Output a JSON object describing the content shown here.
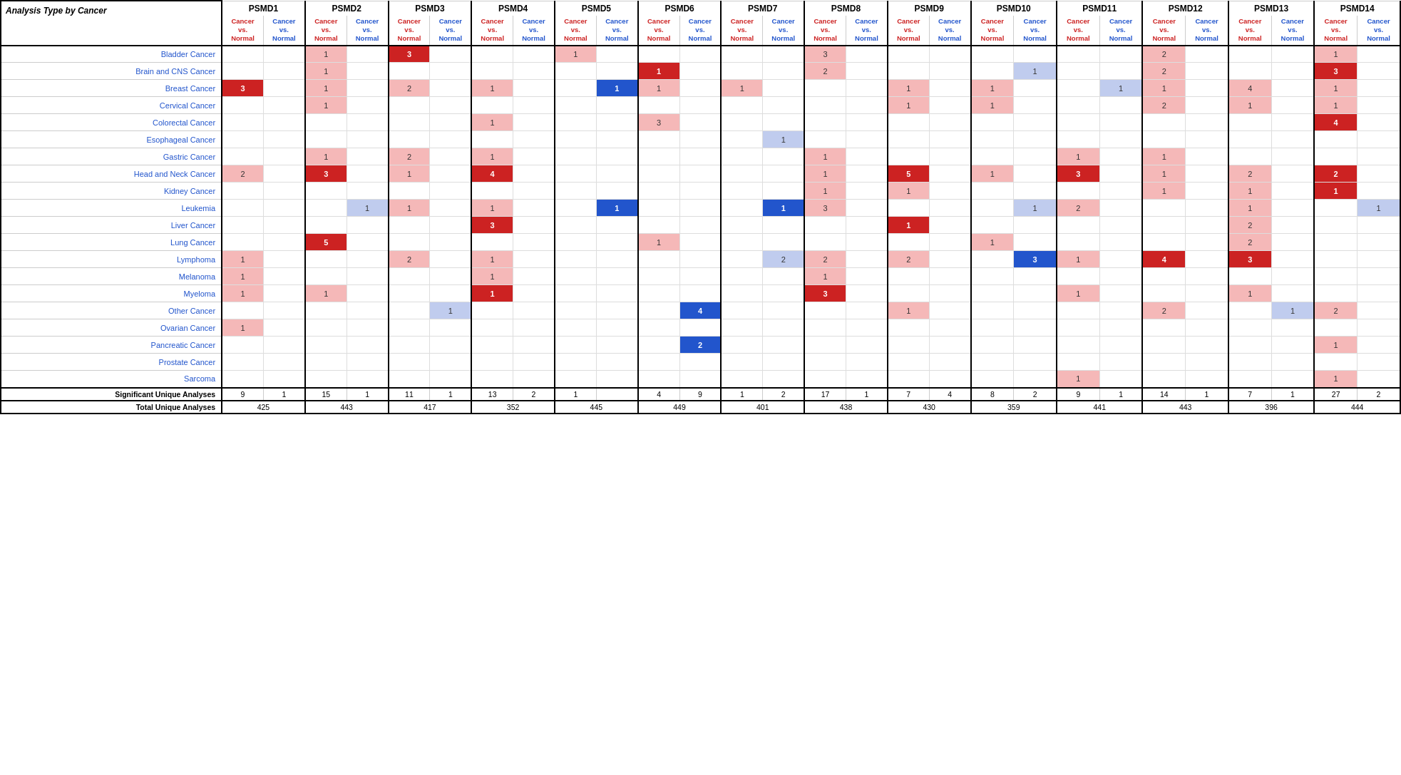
{
  "title": "Analysis Type by Cancer",
  "psmd_columns": [
    {
      "id": "PSMD1",
      "sub": "Cancer vs. Normal"
    },
    {
      "id": "PSMD2",
      "sub": "Cancer vs. Normal"
    },
    {
      "id": "PSMD3",
      "sub": "Cancer vs. Normal"
    },
    {
      "id": "PSMD4",
      "sub": "Cancer vs. Normal"
    },
    {
      "id": "PSMD5",
      "sub": "Cancer vs. Normal"
    },
    {
      "id": "PSMD6",
      "sub": "Cancer vs. Normal"
    },
    {
      "id": "PSMD7",
      "sub": "Cancer vs. Normal"
    },
    {
      "id": "PSMD8",
      "sub": "Cancer vs. Normal"
    },
    {
      "id": "PSMD9",
      "sub": "Cancer vs. Normal"
    },
    {
      "id": "PSMD10",
      "sub": "Cancer vs. Normal"
    },
    {
      "id": "PSMD11",
      "sub": "Cancer vs. Normal"
    },
    {
      "id": "PSMD12",
      "sub": "Cancer vs. Normal"
    },
    {
      "id": "PSMD13",
      "sub": "Cancer vs. Normal"
    },
    {
      "id": "PSMD14",
      "sub": "Cancer vs. Normal"
    }
  ],
  "cancer_rows": [
    {
      "name": "Bladder Cancer",
      "cells": [
        [
          "",
          ""
        ],
        [
          "1",
          "light-red"
        ],
        [
          "3",
          "dark-red"
        ],
        [
          "",
          ""
        ],
        [
          "1",
          "light-red"
        ],
        [
          "",
          ""
        ],
        [
          "",
          ""
        ],
        [
          "3",
          "light-red"
        ],
        [
          "",
          ""
        ],
        [
          "",
          ""
        ],
        [
          "",
          ""
        ],
        [
          "2",
          "light-red"
        ],
        [
          "",
          ""
        ],
        [
          "1",
          "light-red"
        ]
      ]
    },
    {
      "name": "Brain and CNS Cancer",
      "cells": [
        [
          "",
          ""
        ],
        [
          "1",
          "light-red"
        ],
        [
          "",
          ""
        ],
        [
          "",
          ""
        ],
        [
          "",
          ""
        ],
        [
          "1",
          "dark-red"
        ],
        [
          "",
          ""
        ],
        [
          "2",
          "light-red"
        ],
        [
          "",
          ""
        ],
        [
          "1",
          "light-blue"
        ],
        [
          "",
          ""
        ],
        [
          "2",
          "light-red"
        ],
        [
          "",
          ""
        ],
        [
          "3",
          "dark-red"
        ]
      ]
    },
    {
      "name": "Breast Cancer",
      "cells": [
        [
          "3",
          "dark-red"
        ],
        [
          "1",
          "light-red"
        ],
        [
          "2",
          "light-red"
        ],
        [
          "1",
          "light-red"
        ],
        [
          "1",
          "dark-blue"
        ],
        [
          "1",
          "light-red"
        ],
        [
          "1",
          "light-red"
        ],
        [
          "",
          ""
        ],
        [
          "1",
          "light-red"
        ],
        [
          "1",
          "light-red"
        ],
        [
          "1",
          "light-blue"
        ],
        [
          "1",
          "light-red"
        ],
        [
          "4",
          "light-red"
        ],
        [
          "1",
          "light-red"
        ]
      ]
    },
    {
      "name": "Cervical Cancer",
      "cells": [
        [
          "",
          ""
        ],
        [
          "1",
          "light-red"
        ],
        [
          "",
          ""
        ],
        [
          "",
          ""
        ],
        [
          "",
          ""
        ],
        [
          "",
          ""
        ],
        [
          "",
          ""
        ],
        [
          "",
          ""
        ],
        [
          "1",
          "light-red"
        ],
        [
          "1",
          "light-red"
        ],
        [
          "",
          ""
        ],
        [
          "2",
          "light-red"
        ],
        [
          "1",
          "light-red"
        ],
        [
          "1",
          "light-red"
        ]
      ]
    },
    {
      "name": "Colorectal Cancer",
      "cells": [
        [
          "",
          ""
        ],
        [
          "",
          ""
        ],
        [
          "",
          ""
        ],
        [
          "1",
          "light-red"
        ],
        [
          "",
          ""
        ],
        [
          "3",
          "light-red"
        ],
        [
          "",
          ""
        ],
        [
          "",
          ""
        ],
        [
          "",
          ""
        ],
        [
          "",
          ""
        ],
        [
          "",
          ""
        ],
        [
          "",
          ""
        ],
        [
          "",
          ""
        ],
        [
          "4",
          "dark-red"
        ]
      ]
    },
    {
      "name": "Esophageal Cancer",
      "cells": [
        [
          "",
          ""
        ],
        [
          "",
          ""
        ],
        [
          "",
          ""
        ],
        [
          "",
          ""
        ],
        [
          "",
          ""
        ],
        [
          "",
          ""
        ],
        [
          "1",
          "light-blue"
        ],
        [
          "",
          ""
        ],
        [
          "",
          ""
        ],
        [
          "",
          ""
        ],
        [
          "",
          ""
        ],
        [
          "",
          ""
        ],
        [
          "",
          ""
        ],
        [
          "",
          ""
        ]
      ]
    },
    {
      "name": "Gastric Cancer",
      "cells": [
        [
          "",
          ""
        ],
        [
          "1",
          "light-red"
        ],
        [
          "2",
          "light-red"
        ],
        [
          "1",
          "light-red"
        ],
        [
          "",
          ""
        ],
        [
          "",
          ""
        ],
        [
          "",
          ""
        ],
        [
          "1",
          "light-red"
        ],
        [
          "",
          ""
        ],
        [
          "",
          ""
        ],
        [
          "1",
          "light-red"
        ],
        [
          "1",
          "light-red"
        ],
        [
          "",
          ""
        ],
        [
          "",
          ""
        ]
      ]
    },
    {
      "name": "Head and Neck Cancer",
      "cells": [
        [
          "2",
          "light-red"
        ],
        [
          "3",
          "dark-red"
        ],
        [
          "1",
          "light-red"
        ],
        [
          "4",
          "dark-red"
        ],
        [
          "",
          ""
        ],
        [
          "",
          ""
        ],
        [
          "",
          ""
        ],
        [
          "1",
          "light-red"
        ],
        [
          "5",
          "dark-red"
        ],
        [
          "1",
          "light-red"
        ],
        [
          "3",
          "dark-red"
        ],
        [
          "1",
          "light-red"
        ],
        [
          "2",
          "light-red"
        ],
        [
          "2",
          "dark-red"
        ]
      ]
    },
    {
      "name": "Kidney Cancer",
      "cells": [
        [
          "",
          ""
        ],
        [
          "",
          ""
        ],
        [
          "",
          ""
        ],
        [
          "",
          ""
        ],
        [
          "",
          ""
        ],
        [
          "",
          ""
        ],
        [
          "",
          ""
        ],
        [
          "1",
          "light-red"
        ],
        [
          "1",
          "light-red"
        ],
        [
          "",
          ""
        ],
        [
          "",
          ""
        ],
        [
          "1",
          "light-red"
        ],
        [
          "1",
          "light-red"
        ],
        [
          "1",
          "dark-red"
        ]
      ]
    },
    {
      "name": "Leukemia",
      "cells": [
        [
          "",
          ""
        ],
        [
          "1",
          "light-blue"
        ],
        [
          "1",
          "light-red"
        ],
        [
          "1",
          "light-red"
        ],
        [
          "1",
          "dark-blue"
        ],
        [
          "",
          ""
        ],
        [
          "1",
          "dark-blue"
        ],
        [
          "3",
          "light-red"
        ],
        [
          "",
          ""
        ],
        [
          "1",
          "light-blue"
        ],
        [
          "2",
          "light-red"
        ],
        [
          "",
          ""
        ],
        [
          "1",
          "light-red"
        ],
        [
          "1",
          "light-blue"
        ]
      ]
    },
    {
      "name": "Liver Cancer",
      "cells": [
        [
          "",
          ""
        ],
        [
          "",
          ""
        ],
        [
          "",
          ""
        ],
        [
          "3",
          "dark-red"
        ],
        [
          "",
          ""
        ],
        [
          "",
          ""
        ],
        [
          "",
          ""
        ],
        [
          "",
          ""
        ],
        [
          "1",
          "dark-red"
        ],
        [
          "",
          ""
        ],
        [
          "",
          ""
        ],
        [
          "",
          ""
        ],
        [
          "2",
          "light-red"
        ],
        [
          "",
          ""
        ]
      ]
    },
    {
      "name": "Lung Cancer",
      "cells": [
        [
          "",
          ""
        ],
        [
          "5",
          "dark-red"
        ],
        [
          "",
          ""
        ],
        [
          "",
          ""
        ],
        [
          "",
          ""
        ],
        [
          "1",
          "light-red"
        ],
        [
          "",
          ""
        ],
        [
          "",
          ""
        ],
        [
          "",
          ""
        ],
        [
          "1",
          "light-red"
        ],
        [
          "",
          ""
        ],
        [
          "",
          ""
        ],
        [
          "2",
          "light-red"
        ],
        [
          "",
          ""
        ]
      ]
    },
    {
      "name": "Lymphoma",
      "cells": [
        [
          "1",
          "light-red"
        ],
        [
          "",
          ""
        ],
        [
          "2",
          "light-red"
        ],
        [
          "1",
          "light-red"
        ],
        [
          "",
          ""
        ],
        [
          "",
          ""
        ],
        [
          "2",
          "light-blue"
        ],
        [
          "2",
          "light-red"
        ],
        [
          "2",
          "light-red"
        ],
        [
          "3",
          "dark-blue"
        ],
        [
          "1",
          "light-red"
        ],
        [
          "4",
          "dark-red"
        ],
        [
          "3",
          "dark-red"
        ],
        [
          "",
          ""
        ]
      ]
    },
    {
      "name": "Melanoma",
      "cells": [
        [
          "1",
          "light-red"
        ],
        [
          "",
          ""
        ],
        [
          "",
          ""
        ],
        [
          "1",
          "light-red"
        ],
        [
          "",
          ""
        ],
        [
          "",
          ""
        ],
        [
          "",
          ""
        ],
        [
          "1",
          "light-red"
        ],
        [
          "",
          ""
        ],
        [
          "",
          ""
        ],
        [
          "",
          ""
        ],
        [
          "",
          ""
        ],
        [
          "",
          ""
        ],
        [
          "",
          ""
        ]
      ]
    },
    {
      "name": "Myeloma",
      "cells": [
        [
          "1",
          "light-red"
        ],
        [
          "1",
          "light-red"
        ],
        [
          "",
          ""
        ],
        [
          "1",
          "dark-red"
        ],
        [
          "",
          ""
        ],
        [
          "",
          ""
        ],
        [
          "",
          ""
        ],
        [
          "3",
          "dark-red"
        ],
        [
          "",
          ""
        ],
        [
          "",
          ""
        ],
        [
          "1",
          "light-red"
        ],
        [
          "",
          ""
        ],
        [
          "1",
          "light-red"
        ],
        [
          "",
          ""
        ]
      ]
    },
    {
      "name": "Other Cancer",
      "cells": [
        [
          "",
          ""
        ],
        [
          "",
          ""
        ],
        [
          "1",
          "light-blue"
        ],
        [
          "",
          ""
        ],
        [
          "",
          ""
        ],
        [
          "4",
          "dark-blue"
        ],
        [
          "",
          ""
        ],
        [
          "",
          ""
        ],
        [
          "1",
          "light-red"
        ],
        [
          "",
          ""
        ],
        [
          "",
          ""
        ],
        [
          "2",
          "light-red"
        ],
        [
          "1",
          "light-blue"
        ],
        [
          "2",
          "light-red"
        ]
      ]
    },
    {
      "name": "Ovarian Cancer",
      "cells": [
        [
          "1",
          "light-red"
        ],
        [
          "",
          ""
        ],
        [
          "",
          ""
        ],
        [
          "",
          ""
        ],
        [
          "",
          ""
        ],
        [
          "",
          ""
        ],
        [
          "",
          ""
        ],
        [
          "",
          ""
        ],
        [
          "",
          ""
        ],
        [
          "",
          ""
        ],
        [
          "",
          ""
        ],
        [
          "",
          ""
        ],
        [
          "",
          ""
        ],
        [
          "",
          ""
        ]
      ]
    },
    {
      "name": "Pancreatic Cancer",
      "cells": [
        [
          "",
          ""
        ],
        [
          "",
          ""
        ],
        [
          "",
          ""
        ],
        [
          "",
          ""
        ],
        [
          "",
          ""
        ],
        [
          "2",
          "dark-blue"
        ],
        [
          "",
          ""
        ],
        [
          "",
          ""
        ],
        [
          "",
          ""
        ],
        [
          "",
          ""
        ],
        [
          "",
          ""
        ],
        [
          "",
          ""
        ],
        [
          "",
          ""
        ],
        [
          "1",
          "light-red"
        ]
      ]
    },
    {
      "name": "Prostate Cancer",
      "cells": [
        [
          "",
          ""
        ],
        [
          "",
          ""
        ],
        [
          "",
          ""
        ],
        [
          "",
          ""
        ],
        [
          "",
          ""
        ],
        [
          "",
          ""
        ],
        [
          "",
          ""
        ],
        [
          "",
          ""
        ],
        [
          "",
          ""
        ],
        [
          "",
          ""
        ],
        [
          "",
          ""
        ],
        [
          "",
          ""
        ],
        [
          "",
          ""
        ],
        [
          "",
          ""
        ]
      ]
    },
    {
      "name": "Sarcoma",
      "cells": [
        [
          "",
          ""
        ],
        [
          "",
          ""
        ],
        [
          "",
          ""
        ],
        [
          "",
          ""
        ],
        [
          "",
          ""
        ],
        [
          "",
          ""
        ],
        [
          "",
          ""
        ],
        [
          "",
          ""
        ],
        [
          "",
          ""
        ],
        [
          "",
          ""
        ],
        [
          "1",
          "light-red"
        ],
        [
          "",
          ""
        ],
        [
          "",
          ""
        ],
        [
          "1",
          "light-red"
        ]
      ]
    }
  ],
  "significant_unique": {
    "label": "Significant Unique Analyses",
    "values": [
      [
        "9",
        "1"
      ],
      [
        "15",
        "1"
      ],
      [
        "11",
        "1"
      ],
      [
        "13",
        "2"
      ],
      [
        "1",
        ""
      ],
      [
        "4",
        "9"
      ],
      [
        "1",
        "2"
      ],
      [
        "17",
        "1"
      ],
      [
        "7",
        "4"
      ],
      [
        "8",
        "2"
      ],
      [
        "9",
        "1"
      ],
      [
        "14",
        "1"
      ],
      [
        "7",
        "1"
      ],
      [
        "27",
        "2"
      ]
    ]
  },
  "total_unique": {
    "label": "Total Unique Analyses",
    "values": [
      "425",
      "443",
      "417",
      "352",
      "445",
      "449",
      "401",
      "438",
      "430",
      "359",
      "441",
      "443",
      "396",
      "444"
    ]
  }
}
